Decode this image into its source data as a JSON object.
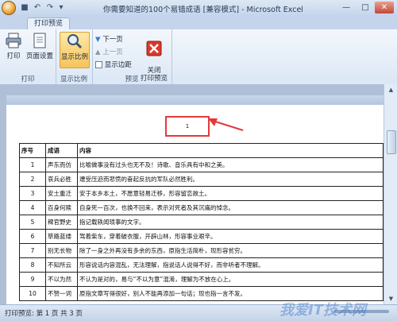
{
  "window": {
    "title": "你需要知道的100个易错成语  [兼容模式] - Microsoft Excel"
  },
  "ribbon": {
    "active_tab": "打印预览",
    "groups": {
      "print": {
        "label": "打印",
        "print_button": "打印",
        "page_setup_button": "页面设置"
      },
      "zoom": {
        "label": "显示比例",
        "zoom_button": "显示比例"
      },
      "preview": {
        "label": "预览",
        "next_page": "下一页",
        "prev_page": "上一页",
        "show_margins": "显示边距",
        "close_button": "关闭\n打印预览"
      }
    }
  },
  "page": {
    "page_number": "1"
  },
  "table": {
    "headers": [
      "序号",
      "成语",
      "内容"
    ],
    "rows": [
      [
        "1",
        "声东而仿",
        "比喻做事没有过头也无不及！诗歌、音乐具有中和之美。"
      ],
      [
        "2",
        "哀兵必胜",
        "遭受压迫而悲愤的奋起反抗的军队必然胜利。"
      ],
      [
        "3",
        "安土重迁",
        "安于本乡本土，不愿意轻易迁移，形容留恋故土。"
      ],
      [
        "4",
        "百身何赎",
        "自身死一百次，也换不回来，表示对死者及其沉痛的悼念。"
      ],
      [
        "5",
        "稗官野史",
        "指记载轶闻琐事的文字。"
      ],
      [
        "6",
        "筚路蓝缕",
        "驾着柴车，穿着破衣服，开辟山林，形容事业艰辛。"
      ],
      [
        "7",
        "别无长物",
        "除了一身之外再没有多余的东西，原指生活简朴，现形容贫穷。"
      ],
      [
        "8",
        "不知所云",
        "形容说话内容混乱，无法理解，指说话人说得不好，而非听者不理解。"
      ],
      [
        "9",
        "不以为然",
        "不认为是对的，易与“不以为意”混淆，理解为不放在心上。"
      ],
      [
        "10",
        "不赞一词",
        "原指文章写得很好，别人不能再添加一句话；现也指一言不发。"
      ]
    ]
  },
  "status": {
    "text": "打印预览: 第 1 页 共 3 页",
    "watermark": "我爱IT技术网"
  },
  "colors": {
    "accent": "#e23a3a",
    "ribbon_bg": "#dbe7f5",
    "active_button": "#f7c35a"
  }
}
